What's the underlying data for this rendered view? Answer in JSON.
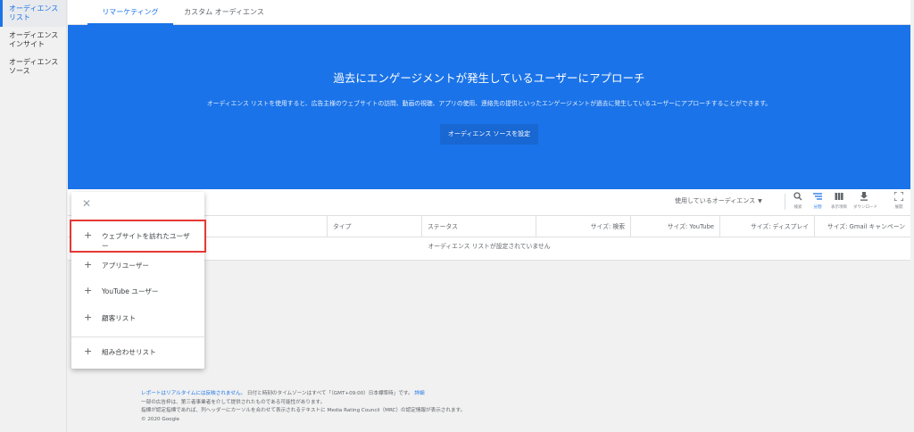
{
  "sidebar": {
    "items": [
      {
        "label": "オーディエンス リスト",
        "active": true
      },
      {
        "label": "オーディエンス インサイト",
        "active": false
      },
      {
        "label": "オーディエンス ソース",
        "active": false
      }
    ]
  },
  "tabs": [
    "リマーケティング",
    "カスタム オーディエンス"
  ],
  "hero": {
    "title": "過去にエンゲージメントが発生しているユーザーにアプローチ",
    "description": "オーディエンス リストを使用すると、広告主様のウェブサイトの訪問、動画の視聴、アプリの使用、連絡先の提供といったエンゲージメントが過去に発生しているユーザーにアプローチすることができます。",
    "button": "オーディエンス ソースを設定"
  },
  "toolbar": {
    "filter_label": "使用しているオーディエンス",
    "tools": [
      {
        "icon": "search-icon",
        "label": "検索"
      },
      {
        "icon": "segment-icon",
        "label": "分割"
      },
      {
        "icon": "columns-icon",
        "label": "表示項目"
      },
      {
        "icon": "download-icon",
        "label": "ダウンロード"
      },
      {
        "icon": "fullscreen-icon",
        "label": "展開"
      }
    ]
  },
  "table": {
    "columns": [
      "タイプ",
      "ステータス",
      "サイズ: 検索",
      "サイズ: YouTube",
      "サイズ: ディスプレイ",
      "サイズ: Gmail キャンペーン"
    ],
    "empty_message": "オーディエンス リストが設定されていません"
  },
  "popup": {
    "items": [
      "ウェブサイトを訪れたユーザー",
      "アプリユーザー",
      "YouTube ユーザー",
      "顧客リスト",
      "組み合わせリスト"
    ]
  },
  "footer": {
    "line1_link": "レポートはリアルタイムには反映されません。",
    "line1_text": "日付と時刻のタイムゾーンはすべて「（GMT+09:00）日本標準時」です。",
    "line1_detail": "詳細",
    "line2": "一部の広告枠は、第三者事業者を介して提供されたものである可能性があります。",
    "line3": "指標が認定指標であれば、列ヘッダーにカーソルを合わせて表示されるテキストに Media Rating Council（MRC）の認定情報が表示されます。",
    "copyright": "© 2020 Google"
  },
  "colors": {
    "accent": "#1a73e8",
    "highlight": "#e53935"
  }
}
